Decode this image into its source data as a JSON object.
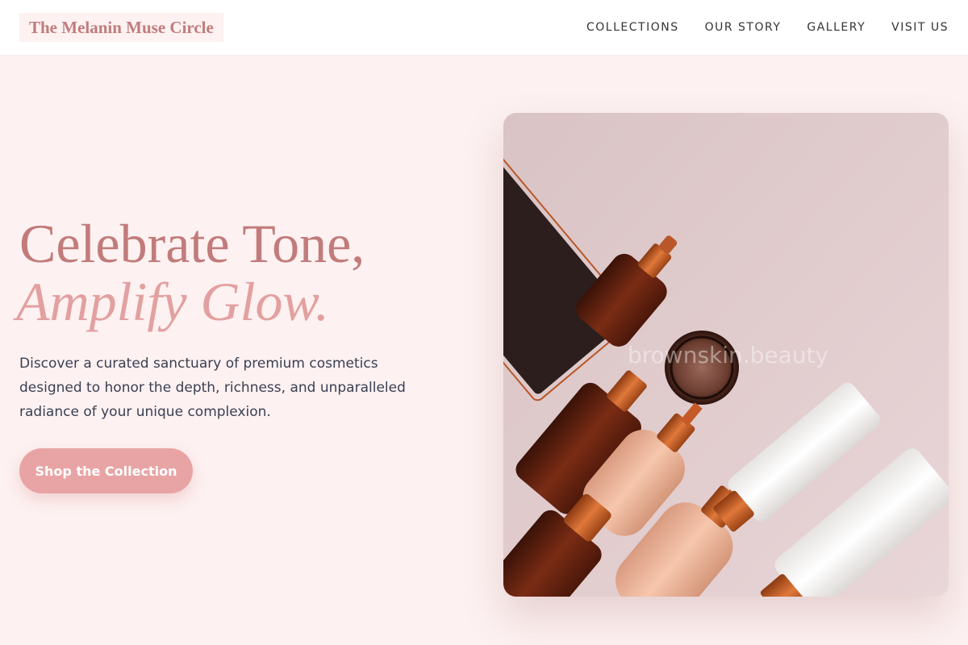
{
  "brand": {
    "name": "The Melanin Muse Circle"
  },
  "nav": {
    "items": [
      {
        "label": "COLLECTIONS"
      },
      {
        "label": "OUR STORY"
      },
      {
        "label": "GALLERY"
      },
      {
        "label": "VISIT US"
      }
    ]
  },
  "hero": {
    "title_line1": "Celebrate Tone,",
    "title_line2": "Amplify Glow.",
    "description": "Discover a curated sanctuary of premium cosmetics designed to honor the depth, richness, and unparalleled radiance of your unique complexion.",
    "cta_label": "Shop the Collection",
    "image_watermark": "brownskin.beauty"
  },
  "colors": {
    "page_background": "#fdf1f1",
    "brand_rose": "#c27b7b",
    "accent_pink": "#e8a4a4",
    "body_text": "#3a3f52"
  }
}
